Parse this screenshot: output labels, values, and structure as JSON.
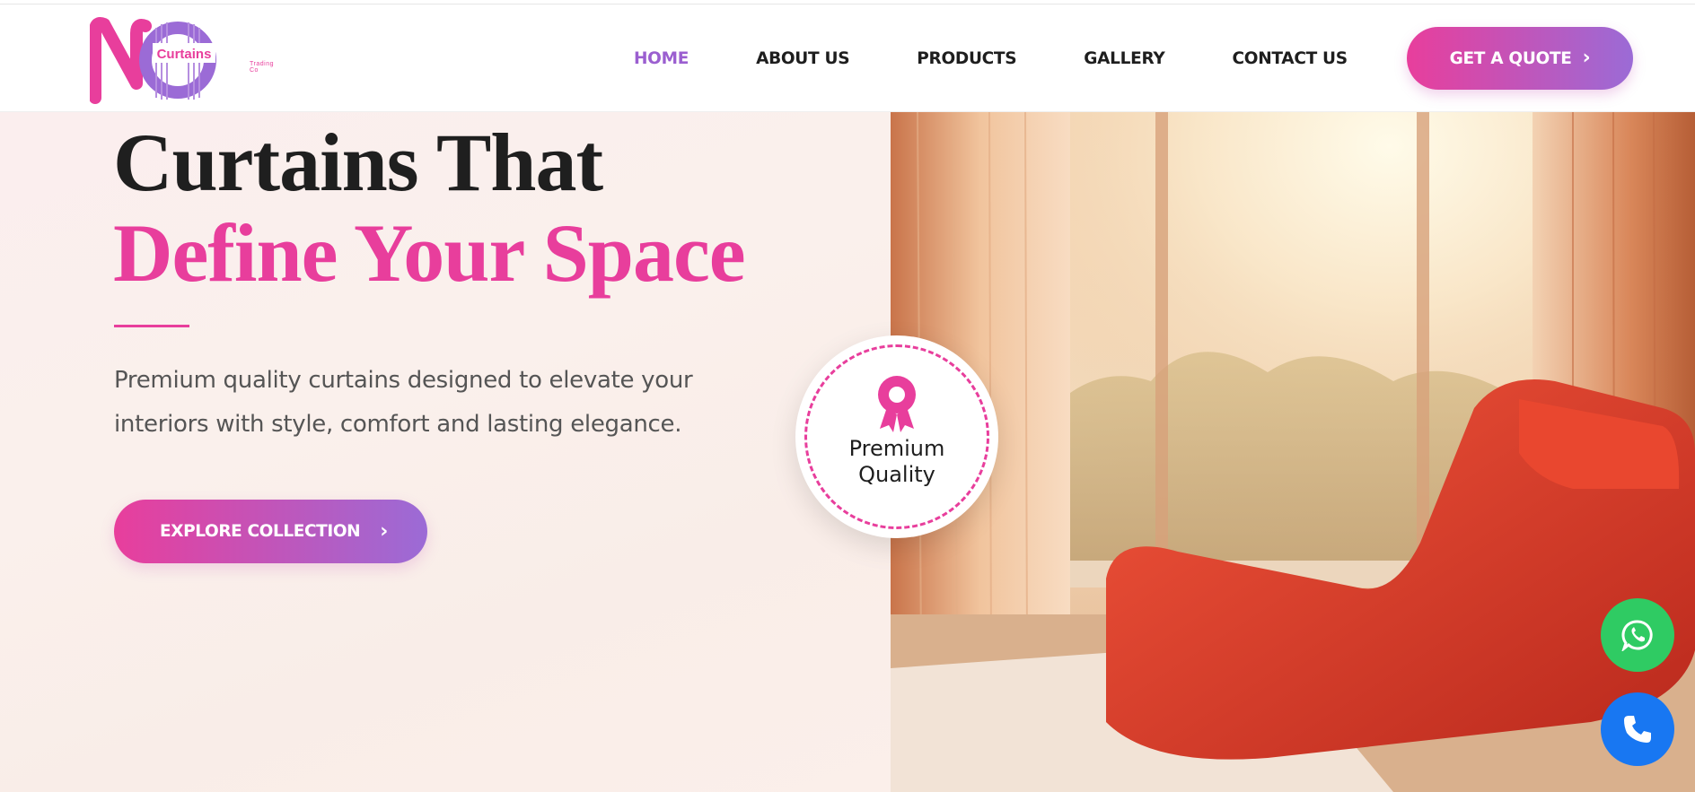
{
  "brand": {
    "logo_text": "Curtains",
    "logo_subtext": "Trading Co"
  },
  "nav": {
    "items": [
      {
        "label": "HOME",
        "active": true
      },
      {
        "label": "ABOUT US",
        "active": false
      },
      {
        "label": "PRODUCTS",
        "active": false
      },
      {
        "label": "GALLERY",
        "active": false
      },
      {
        "label": "CONTACT US",
        "active": false
      }
    ],
    "cta_label": "GET A QUOTE"
  },
  "hero": {
    "title_line1": "Curtains That",
    "title_line2": "Define Your Space",
    "description": "Premium quality curtains designed to elevate your interiors with style, comfort and lasting elegance.",
    "button_label": "EXPLORE COLLECTION"
  },
  "badge": {
    "line1": "Premium",
    "line2": "Quality",
    "icon": "award-ribbon-icon"
  },
  "floating": {
    "whatsapp_icon": "whatsapp-icon",
    "phone_icon": "phone-icon"
  },
  "colors": {
    "accent_pink": "#e83e9c",
    "accent_purple": "#9b5fd0",
    "whatsapp": "#2fcb63",
    "phone": "#1877f2"
  }
}
